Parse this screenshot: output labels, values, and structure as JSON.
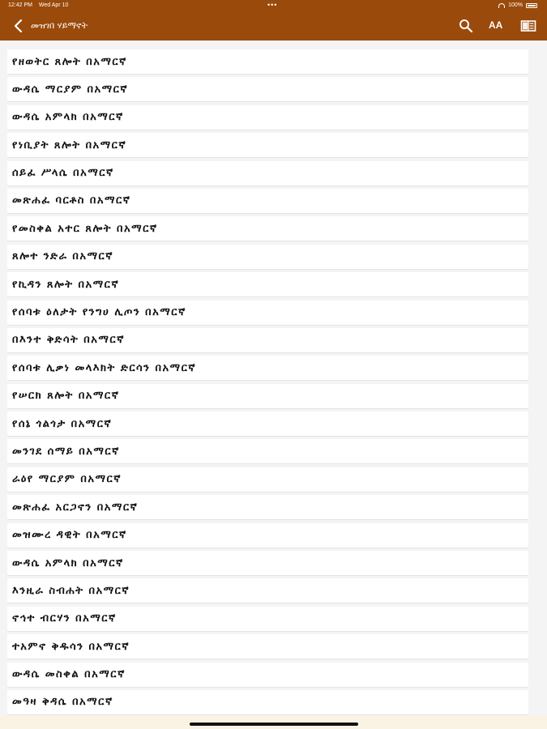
{
  "status_bar": {
    "time": "12:42 PM",
    "date": "Wed Apr 10",
    "dots": "•••",
    "battery": "100%"
  },
  "nav": {
    "title": "መዝገበ ሃይማኖት",
    "font_label": "AA"
  },
  "items": [
    "የዘወትር ጸሎት በአማርኛ",
    "ውዳሴ ማርያም በአማርኛ",
    "ውዳሴ አምላክ በአማርኛ",
    "የነቢያት ጸሎት በአማርኛ",
    "ሰይፈ ሥላሴ በአማርኛ",
    "መጽሐፈ ባርቶስ በአማርኛ",
    "የመስቀል አተር ጸሎት በአማርኛ",
    "ጸሎተ ንድራ በአማርኛ",
    "የኪዳን ጸሎት በአማርኛ",
    "የሰባቱ ዕለታት የንግሀ ሊጦን በአማርኛ",
    "በእንተ ቅድሳት በአማርኛ",
    "የሰባቱ ሊቃነ መላእክት ድርሳን በአማርኛ",
    "የሠርክ ጸሎት በአማርኛ",
    "የሰኔ ጎልጎታ በአማርኛ",
    "መንገደ ሰማይ በአማርኛ",
    "ራዕየ ማርያም በአማርኛ",
    "መጽሐፈ አርጋኖን በአማርኛ",
    "መዝሙረ ዳዊት በአማርኛ",
    "ውዳሴ አምላክ በአማርኛ",
    "እንዚራ ስብሐት በአማርኛ",
    "ኖኅተ ብርሃን በአማርኛ",
    "ተአምኖ ቅዱሳን በአማርኛ",
    "ውዳሴ መስቀል በአማርኛ",
    "መዓዛ ቅዳሴ በአማርኛ"
  ],
  "colors": {
    "header_bg": "#9a4a0b",
    "list_bg": "#ffffff",
    "page_bg": "#f4f4f4"
  }
}
